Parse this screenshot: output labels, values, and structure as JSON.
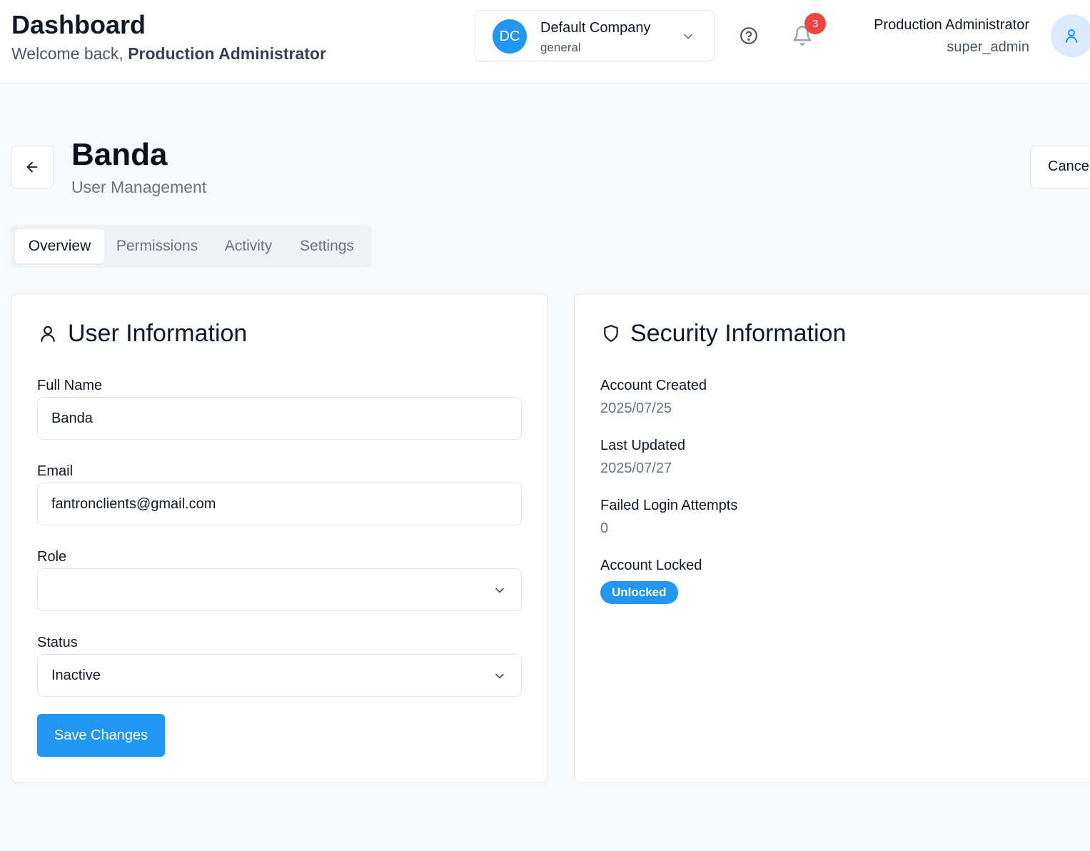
{
  "header": {
    "title": "Dashboard",
    "welcome_prefix": "Welcome back,",
    "welcome_name": "Production Administrator",
    "company": {
      "initials": "DC",
      "name": "Default Company",
      "sub": "general"
    },
    "notifications_count": "3",
    "user": {
      "name": "Production Administrator",
      "role": "super_admin"
    }
  },
  "page": {
    "title": "Banda",
    "subtitle": "User Management",
    "cancel_label": "Cancel"
  },
  "tabs": [
    {
      "label": "Overview",
      "active": true
    },
    {
      "label": "Permissions",
      "active": false
    },
    {
      "label": "Activity",
      "active": false
    },
    {
      "label": "Settings",
      "active": false
    }
  ],
  "user_info": {
    "title": "User Information",
    "full_name_label": "Full Name",
    "full_name_value": "Banda",
    "email_label": "Email",
    "email_value": "fantronclients@gmail.com",
    "role_label": "Role",
    "role_value": "",
    "status_label": "Status",
    "status_value": "Inactive",
    "save_label": "Save Changes"
  },
  "security_info": {
    "title": "Security Information",
    "created_label": "Account Created",
    "created_value": "2025/07/25",
    "updated_label": "Last Updated",
    "updated_value": "2025/07/27",
    "failed_label": "Failed Login Attempts",
    "failed_value": "0",
    "locked_label": "Account Locked",
    "locked_value": "Unlocked"
  },
  "colors": {
    "accent": "#2196f3",
    "badge": "#ef4444"
  },
  "icons": [
    "chevron-down-icon",
    "help-circle-icon",
    "bell-icon",
    "user-icon",
    "arrow-left-icon",
    "shield-icon"
  ]
}
